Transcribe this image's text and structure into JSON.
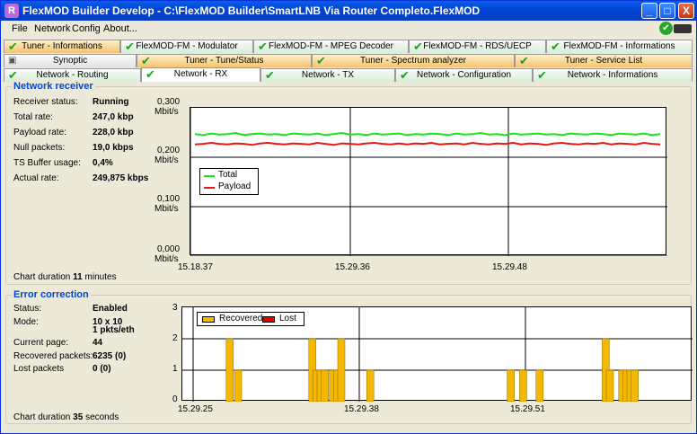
{
  "window": {
    "title": "FlexMOD Builder Develop - C:\\FlexMOD Builder\\SmartLNB Via Router Completo.FlexMOD",
    "min": "_",
    "max": "□",
    "close": "X",
    "app_icon": "R"
  },
  "menu": [
    "File",
    "Network",
    "Config",
    "About..."
  ],
  "tabs_row1": [
    {
      "label": "Tuner - Informations",
      "check": true,
      "style": "orange"
    },
    {
      "label": "FlexMOD-FM - Modulator",
      "check": true,
      "style": "green"
    },
    {
      "label": "FlexMOD-FM - MPEG Decoder",
      "check": true,
      "style": "green"
    },
    {
      "label": "FlexMOD-FM - RDS/UECP",
      "check": true,
      "style": "green"
    },
    {
      "label": "FlexMOD-FM - Informations",
      "check": true,
      "style": "green"
    }
  ],
  "tabs_row2": [
    {
      "label": "Synoptic",
      "check": false,
      "style": "gray"
    },
    {
      "label": "Tuner - Tune/Status",
      "check": true,
      "style": "orange"
    },
    {
      "label": "Tuner - Spectrum analyzer",
      "check": true,
      "style": "orange"
    },
    {
      "label": "Tuner - Service List",
      "check": true,
      "style": "orange"
    }
  ],
  "tabs_row3": [
    {
      "label": "Network - Routing",
      "check": true,
      "style": "green"
    },
    {
      "label": "Network - RX",
      "check": true,
      "style": "active"
    },
    {
      "label": "Network - TX",
      "check": true,
      "style": "green"
    },
    {
      "label": "Network - Configuration",
      "check": true,
      "style": "green"
    },
    {
      "label": "Network - Informations",
      "check": true,
      "style": "green"
    }
  ],
  "receiver": {
    "title": "Network receiver",
    "rows": [
      {
        "label": "Receiver status:",
        "value": "Running"
      },
      {
        "label": "Total rate:",
        "value": "247,0 kbp"
      },
      {
        "label": "Payload rate:",
        "value": "228,0 kbp"
      },
      {
        "label": "Null packets:",
        "value": "19,0 kbps"
      },
      {
        "label": "TS Buffer usage:",
        "value": "0,4%"
      },
      {
        "label": "Actual rate:",
        "value": "249,875 kbps"
      }
    ],
    "duration_prefix": "Chart duration",
    "duration_value": "11",
    "duration_unit": "minutes"
  },
  "errors": {
    "title": "Error correction",
    "rows": [
      {
        "label": "Status:",
        "value": "Enabled"
      },
      {
        "label": "Mode:",
        "value": "10 x 10",
        "value2": "1 pkts/eth"
      },
      {
        "label": "Current page:",
        "value": "44"
      },
      {
        "label": "Recovered packets:",
        "value": "6235 (0)"
      },
      {
        "label": "Lost packets",
        "value": "0 (0)"
      }
    ],
    "duration_prefix": "Chart duration",
    "duration_value": "35",
    "duration_unit": "seconds"
  },
  "colors": {
    "total": "#19e619",
    "payload": "#e61919",
    "recovered": "#f5b800",
    "lost": "#e60000"
  },
  "chart_data": [
    {
      "type": "line",
      "ylim": [
        0,
        0.3
      ],
      "yticks": [
        "0,300",
        "0,200",
        "0,100",
        "0,000"
      ],
      "yunit": "Mbit/s",
      "xticks": [
        "15.18.37",
        "15.29.36",
        "15.29.48"
      ],
      "legend": [
        "Total",
        "Payload"
      ],
      "series": [
        {
          "name": "Total",
          "values": [
            0.247,
            0.245,
            0.248,
            0.246,
            0.247,
            0.249,
            0.245,
            0.247,
            0.248,
            0.246,
            0.247,
            0.245,
            0.248,
            0.247,
            0.246,
            0.248,
            0.245,
            0.247,
            0.249,
            0.246,
            0.247,
            0.245,
            0.248,
            0.246,
            0.247,
            0.248,
            0.245,
            0.247,
            0.246,
            0.248,
            0.247,
            0.245,
            0.248,
            0.246,
            0.247,
            0.249,
            0.246,
            0.247,
            0.245,
            0.248,
            0.246,
            0.247,
            0.248,
            0.246,
            0.247,
            0.245,
            0.248,
            0.247,
            0.246,
            0.248,
            0.247,
            0.245,
            0.248,
            0.247,
            0.246,
            0.248,
            0.245,
            0.247
          ]
        },
        {
          "name": "Payload",
          "values": [
            0.226,
            0.227,
            0.229,
            0.227,
            0.226,
            0.228,
            0.227,
            0.225,
            0.228,
            0.229,
            0.227,
            0.226,
            0.228,
            0.227,
            0.226,
            0.229,
            0.227,
            0.225,
            0.228,
            0.227,
            0.226,
            0.228,
            0.229,
            0.227,
            0.226,
            0.228,
            0.226,
            0.228,
            0.227,
            0.229,
            0.226,
            0.227,
            0.228,
            0.226,
            0.229,
            0.227,
            0.226,
            0.228,
            0.227,
            0.229,
            0.226,
            0.228,
            0.227,
            0.225,
            0.228,
            0.229,
            0.227,
            0.226,
            0.228,
            0.227,
            0.229,
            0.226,
            0.228,
            0.227,
            0.226,
            0.229,
            0.227,
            0.226
          ]
        }
      ]
    },
    {
      "type": "bar",
      "ylim": [
        0,
        3
      ],
      "yticks": [
        "3",
        "2",
        "1",
        "0"
      ],
      "xticks": [
        "15.29.25",
        "15.29.38",
        "15.29.51"
      ],
      "legend": [
        "Recovered",
        "Lost"
      ],
      "n": 60,
      "recovered": [
        0,
        0,
        0,
        0,
        0,
        0,
        0,
        0,
        2,
        0,
        1,
        0,
        0,
        0,
        0,
        0,
        0,
        0,
        0,
        0,
        0,
        0,
        0,
        0,
        0,
        0,
        0,
        0,
        2,
        1,
        1,
        1,
        0,
        1,
        1,
        2,
        0,
        0,
        0,
        0,
        0,
        0,
        1,
        0,
        0,
        0,
        0,
        0,
        0,
        0,
        0,
        0,
        0,
        0,
        0,
        0,
        0,
        0,
        0,
        0,
        0,
        0,
        0,
        0,
        0,
        0,
        0,
        0,
        0,
        0,
        0,
        0,
        0,
        0,
        0,
        0,
        1,
        0,
        0,
        1,
        0,
        0,
        0,
        1,
        0,
        0,
        0,
        0,
        0,
        0,
        0,
        0,
        0,
        0,
        0,
        0,
        0,
        0,
        0,
        2,
        1,
        0,
        0,
        1,
        1,
        1,
        1,
        0,
        0,
        0
      ],
      "lost": []
    }
  ]
}
